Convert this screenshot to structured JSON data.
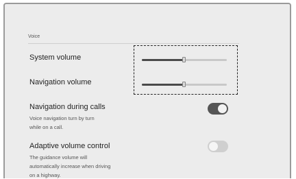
{
  "section": {
    "title": "Voice"
  },
  "system_volume": {
    "label": "System volume",
    "level": 0.5
  },
  "navigation_volume": {
    "label": "Navigation volume",
    "level": 0.5
  },
  "navigation_during_calls": {
    "label": "Navigation during calls",
    "desc_line1": "Voice navigation turn by turn",
    "desc_line2": "while on a call.",
    "enabled": true
  },
  "adaptive_volume": {
    "label": "Adaptive volume control",
    "desc_line1": "The guidance volume will",
    "desc_line2": "automatically increase when driving",
    "desc_line3": "on a highway.",
    "enabled": false
  }
}
